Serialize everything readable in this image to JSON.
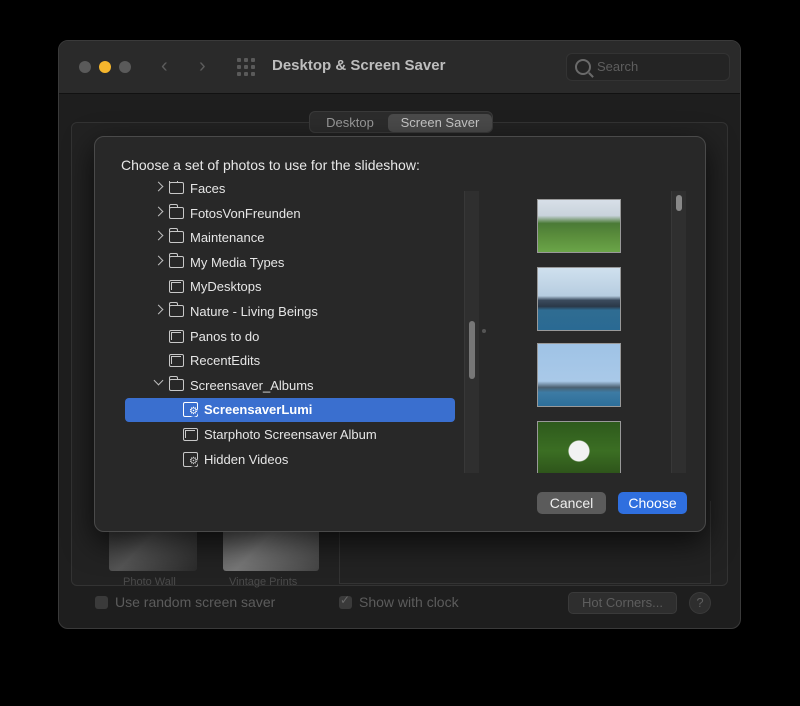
{
  "window": {
    "title": "Desktop & Screen Saver",
    "search_placeholder": "Search",
    "tabs": [
      "Desktop",
      "Screen Saver"
    ],
    "selected_tab": "Screen Saver"
  },
  "background": {
    "thumbnails": [
      "Photo Wall",
      "Vintage Prints"
    ],
    "random_label": "Use random screen saver",
    "random_checked": false,
    "clock_label": "Show with clock",
    "clock_checked": true,
    "hot_corners_label": "Hot Corners...",
    "help_label": "?"
  },
  "sheet": {
    "prompt": "Choose a set of photos to use for the slideshow:",
    "items": [
      {
        "label": "Faces",
        "icon": "folder-icon",
        "chevron": "right",
        "indent": 1
      },
      {
        "label": "FotosVonFreunden",
        "icon": "folder-icon",
        "chevron": "right",
        "indent": 1
      },
      {
        "label": "Maintenance",
        "icon": "folder-icon",
        "chevron": "right",
        "indent": 1
      },
      {
        "label": "My Media Types",
        "icon": "folder-icon",
        "chevron": "right",
        "indent": 1
      },
      {
        "label": "MyDesktops",
        "icon": "album-icon",
        "chevron": "",
        "indent": 1
      },
      {
        "label": "Nature - Living Beings",
        "icon": "folder-icon",
        "chevron": "right",
        "indent": 1
      },
      {
        "label": "Panos to do",
        "icon": "album-icon",
        "chevron": "",
        "indent": 1
      },
      {
        "label": "RecentEdits",
        "icon": "album-icon",
        "chevron": "",
        "indent": 1
      },
      {
        "label": "Screensaver_Albums",
        "icon": "folder-icon",
        "chevron": "down",
        "indent": 1
      },
      {
        "label": "ScreensaverLumi",
        "icon": "smart-album-icon",
        "chevron": "",
        "indent": 2,
        "selected": true
      },
      {
        "label": "Starphoto Screensaver Album",
        "icon": "album-icon",
        "chevron": "",
        "indent": 2
      },
      {
        "label": "Hidden Videos",
        "icon": "smart-album-icon",
        "chevron": "",
        "indent": 2
      }
    ],
    "cancel_label": "Cancel",
    "choose_label": "Choose"
  }
}
